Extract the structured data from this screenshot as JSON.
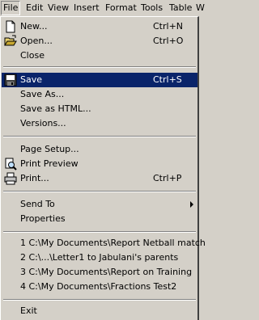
{
  "menubar": {
    "items": [
      "File",
      "Edit",
      "View",
      "Insert",
      "Format",
      "Tools",
      "Table",
      "W"
    ]
  },
  "file_menu": {
    "new": {
      "label": "New...",
      "shortcut": "Ctrl+N"
    },
    "open": {
      "label": "Open...",
      "shortcut": "Ctrl+O"
    },
    "close": {
      "label": "Close"
    },
    "save": {
      "label": "Save",
      "shortcut": "Ctrl+S"
    },
    "save_as": {
      "label": "Save As..."
    },
    "save_as_html": {
      "label": "Save as HTML..."
    },
    "versions": {
      "label": "Versions..."
    },
    "page_setup": {
      "label": "Page Setup..."
    },
    "print_preview": {
      "label": "Print Preview"
    },
    "print": {
      "label": "Print...",
      "shortcut": "Ctrl+P"
    },
    "send_to": {
      "label": "Send To"
    },
    "properties": {
      "label": "Properties"
    },
    "recent_files": [
      "1 C:\\My Documents\\Report Netball match",
      "2 C:\\...\\Letter1 to Jabulani's parents",
      "3 C:\\My Documents\\Report on Training",
      "4 C:\\My Documents\\Fractions Test2"
    ],
    "exit": {
      "label": "Exit"
    }
  },
  "colors": {
    "highlight": "#0a246a",
    "face": "#d4d0c8"
  }
}
